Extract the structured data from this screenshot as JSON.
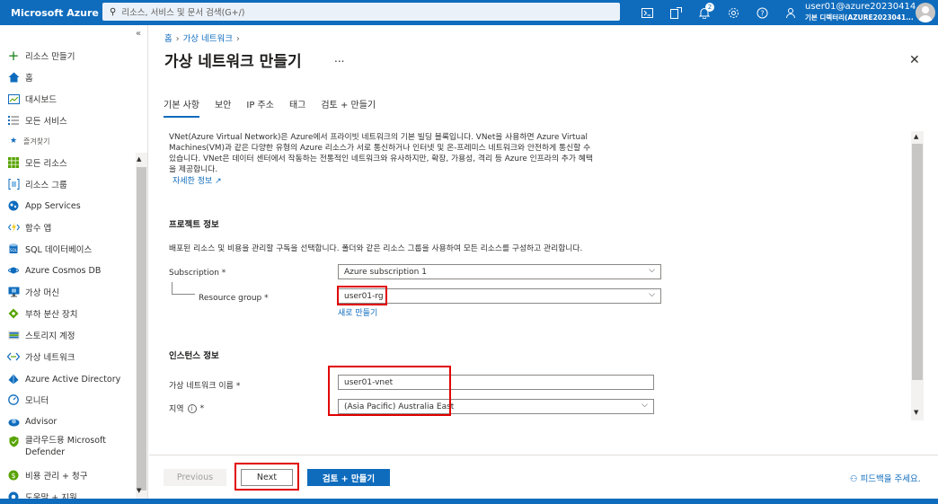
{
  "topbar": {
    "brand": "Microsoft Azure",
    "search_placeholder": "리소스, 서비스 및 문서 검색(G+/)",
    "notification_count": "2",
    "account_user": "user01@azure20230414...",
    "account_directory": "기본 디렉터리(AZURE2023041...",
    "icons": [
      "cloud-shell-icon",
      "directory-filter-icon",
      "bell-icon",
      "gear-icon",
      "help-icon",
      "feedback-icon"
    ]
  },
  "sidebar": {
    "collapse": "«",
    "items": [
      {
        "label": "리소스 만들기",
        "icon": "plus-icon",
        "color": "#107c10"
      },
      {
        "label": "홈",
        "icon": "home-icon",
        "color": "#0f6cbd"
      },
      {
        "label": "대시보드",
        "icon": "dashboard-icon",
        "color": "#0f6cbd"
      },
      {
        "label": "모든 서비스",
        "icon": "list-icon",
        "color": "#0f6cbd"
      },
      {
        "label": "즐겨찾기",
        "icon": "star-icon",
        "color": "#0f6cbd"
      },
      {
        "label": "모든 리소스",
        "icon": "grid-icon",
        "color": "#57a300"
      },
      {
        "label": "리소스 그룹",
        "icon": "resource-group-icon",
        "color": "#0f6cbd"
      },
      {
        "label": "App Services",
        "icon": "app-services-icon",
        "color": "#0f6cbd"
      },
      {
        "label": "함수 앱",
        "icon": "function-icon",
        "color": "#f2c811"
      },
      {
        "label": "SQL 데이터베이스",
        "icon": "sql-icon",
        "color": "#0f6cbd"
      },
      {
        "label": "Azure Cosmos DB",
        "icon": "cosmos-icon",
        "color": "#0f6cbd"
      },
      {
        "label": "가상 머신",
        "icon": "vm-icon",
        "color": "#0f6cbd"
      },
      {
        "label": "부하 분산 장치",
        "icon": "load-balancer-icon",
        "color": "#57a300"
      },
      {
        "label": "스토리지 계정",
        "icon": "storage-icon",
        "color": "#0f6cbd"
      },
      {
        "label": "가상 네트워크",
        "icon": "vnet-icon",
        "color": "#0f6cbd"
      },
      {
        "label": "Azure Active Directory",
        "icon": "aad-icon",
        "color": "#0f6cbd"
      },
      {
        "label": "모니터",
        "icon": "monitor-icon",
        "color": "#0f6cbd"
      },
      {
        "label": "Advisor",
        "icon": "advisor-icon",
        "color": "#0f6cbd"
      },
      {
        "label": "클라우드용 Microsoft",
        "label2": "Defender",
        "icon": "defender-icon",
        "color": "#57a300"
      },
      {
        "label": "비용 관리 + 청구",
        "icon": "cost-icon",
        "color": "#57a300"
      },
      {
        "label": "도움말 + 지원",
        "icon": "help-support-icon",
        "color": "#0f6cbd"
      }
    ]
  },
  "main": {
    "breadcrumb": [
      "홈",
      "가상 네트워크"
    ],
    "title": "가상 네트워크 만들기",
    "more": "...",
    "close": "✕",
    "tabs": [
      "기본 사항",
      "보안",
      "IP 주소",
      "태그",
      "검토 + 만들기"
    ],
    "description": [
      "VNet(Azure Virtual Network)은 Azure에서 프라이빗 네트워크의 기본 빌딩 블록입니다. VNet을 사용하면 Azure Virtual",
      "Machines(VM)과 같은 다양한 유형의 Azure 리소스가 서로 통신하거나 인터넷 및 온-프레미스 네트워크와 안전하게 통신할 수",
      "있습니다. VNet은 데이터 센터에서 작동하는 전통적인 네트워크와 유사하지만, 확장, 가용성, 격리 등 Azure 인프라의 추가 혜택",
      "을 제공합니다."
    ],
    "learn_more": "자세한 정보 ↗",
    "project": {
      "heading": "프로젝트 정보",
      "desc": "배포된 리소스 및 비용을 관리할 구독을 선택합니다. 폴더와 같은 리소스 그룹을 사용하여 모든 리소스를 구성하고 관리합니다.",
      "subscription_label": "Subscription *",
      "subscription_value": "Azure subscription 1",
      "rg_label": "Resource group *",
      "rg_value": "user01-rg",
      "create_new": "새로 만들기"
    },
    "instance": {
      "heading": "인스턴스 정보",
      "name_label": "가상 네트워크 이름 *",
      "name_value": "user01-vnet",
      "region_label": "지역",
      "region_info": "i",
      "region_required": "*",
      "region_value": "(Asia Pacific) Australia East"
    },
    "footer": {
      "previous": "Previous",
      "next": "Next",
      "review": "검토 + 만들기",
      "feedback": "피드백을 주세요."
    }
  },
  "colors": {
    "accent": "#0f6cbd",
    "highlight": "#e00000"
  }
}
